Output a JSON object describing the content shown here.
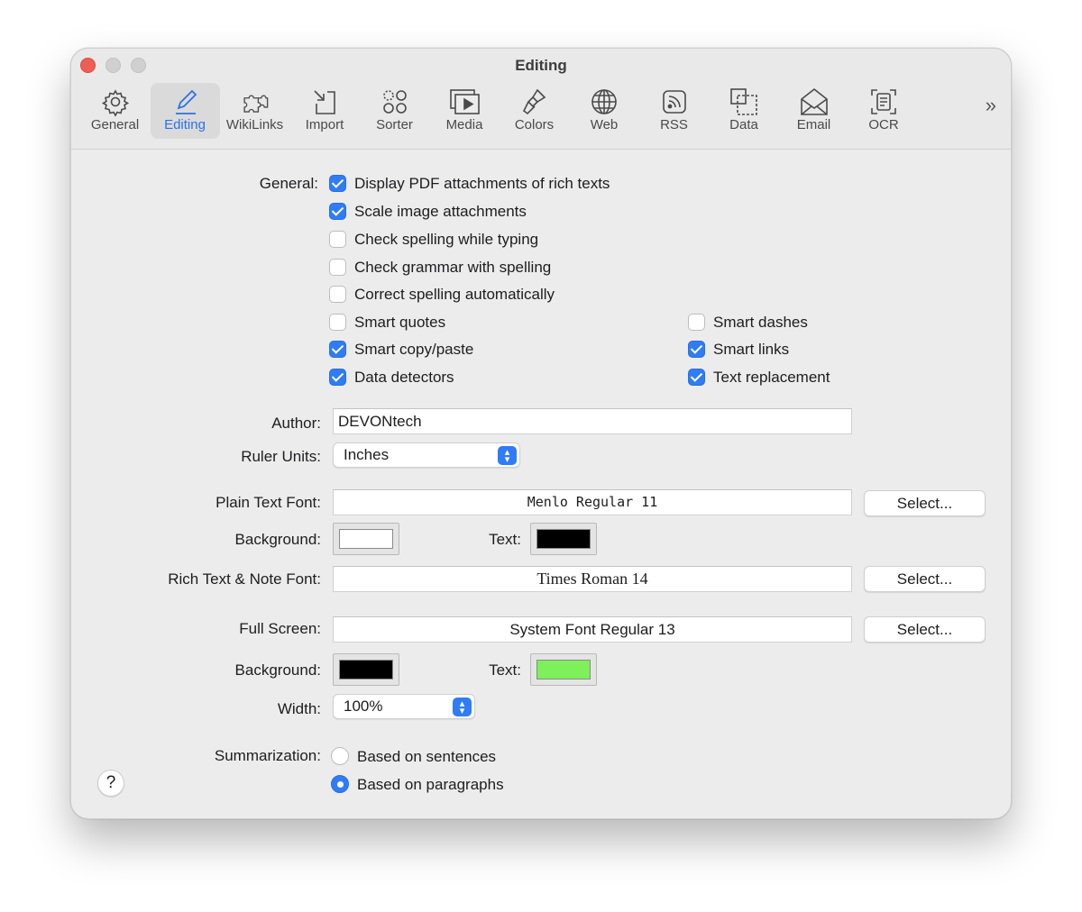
{
  "window": {
    "title": "Editing"
  },
  "toolbar": {
    "items": [
      {
        "label": "General",
        "icon": "gear-icon"
      },
      {
        "label": "Editing",
        "icon": "pen-icon",
        "selected": true
      },
      {
        "label": "WikiLinks",
        "icon": "puzzle-icon"
      },
      {
        "label": "Import",
        "icon": "import-icon"
      },
      {
        "label": "Sorter",
        "icon": "sorter-icon"
      },
      {
        "label": "Media",
        "icon": "media-icon"
      },
      {
        "label": "Colors",
        "icon": "brush-icon"
      },
      {
        "label": "Web",
        "icon": "globe-icon"
      },
      {
        "label": "RSS",
        "icon": "rss-icon"
      },
      {
        "label": "Data",
        "icon": "data-icon"
      },
      {
        "label": "Email",
        "icon": "envelope-icon"
      },
      {
        "label": "OCR",
        "icon": "ocr-icon"
      }
    ],
    "overflow": "»"
  },
  "general": {
    "label": "General:",
    "options": [
      {
        "label": "Display PDF attachments of rich texts",
        "checked": true
      },
      {
        "label": "Scale image attachments",
        "checked": true
      },
      {
        "label": "Check spelling while typing",
        "checked": false
      },
      {
        "label": "Check grammar with spelling",
        "checked": false
      },
      {
        "label": "Correct spelling automatically",
        "checked": false
      },
      {
        "label": "Smart quotes",
        "checked": false
      },
      {
        "label": "Smart dashes",
        "checked": false
      },
      {
        "label": "Smart copy/paste",
        "checked": true
      },
      {
        "label": "Smart links",
        "checked": true
      },
      {
        "label": "Data detectors",
        "checked": true
      },
      {
        "label": "Text replacement",
        "checked": true
      }
    ]
  },
  "author": {
    "label": "Author:",
    "value": "DEVONtech"
  },
  "ruler": {
    "label": "Ruler Units:",
    "value": "Inches"
  },
  "plain_font": {
    "label": "Plain Text Font:",
    "value": "Menlo Regular 11",
    "button": "Select..."
  },
  "plain_colors": {
    "bg_label": "Background:",
    "text_label": "Text:",
    "bg": "#ffffff",
    "text": "#000000"
  },
  "rich_font": {
    "label": "Rich Text & Note Font:",
    "value": "Times Roman 14",
    "button": "Select..."
  },
  "full_screen": {
    "label": "Full Screen:",
    "value": "System Font Regular 13",
    "button": "Select..."
  },
  "fs_colors": {
    "bg_label": "Background:",
    "text_label": "Text:",
    "bg": "#000000",
    "text": "#7ef05a"
  },
  "width": {
    "label": "Width:",
    "value": "100%"
  },
  "summarization": {
    "label": "Summarization:",
    "options": [
      {
        "label": "Based on sentences",
        "selected": false
      },
      {
        "label": "Based on paragraphs",
        "selected": true
      }
    ]
  },
  "help": {
    "label": "?"
  }
}
